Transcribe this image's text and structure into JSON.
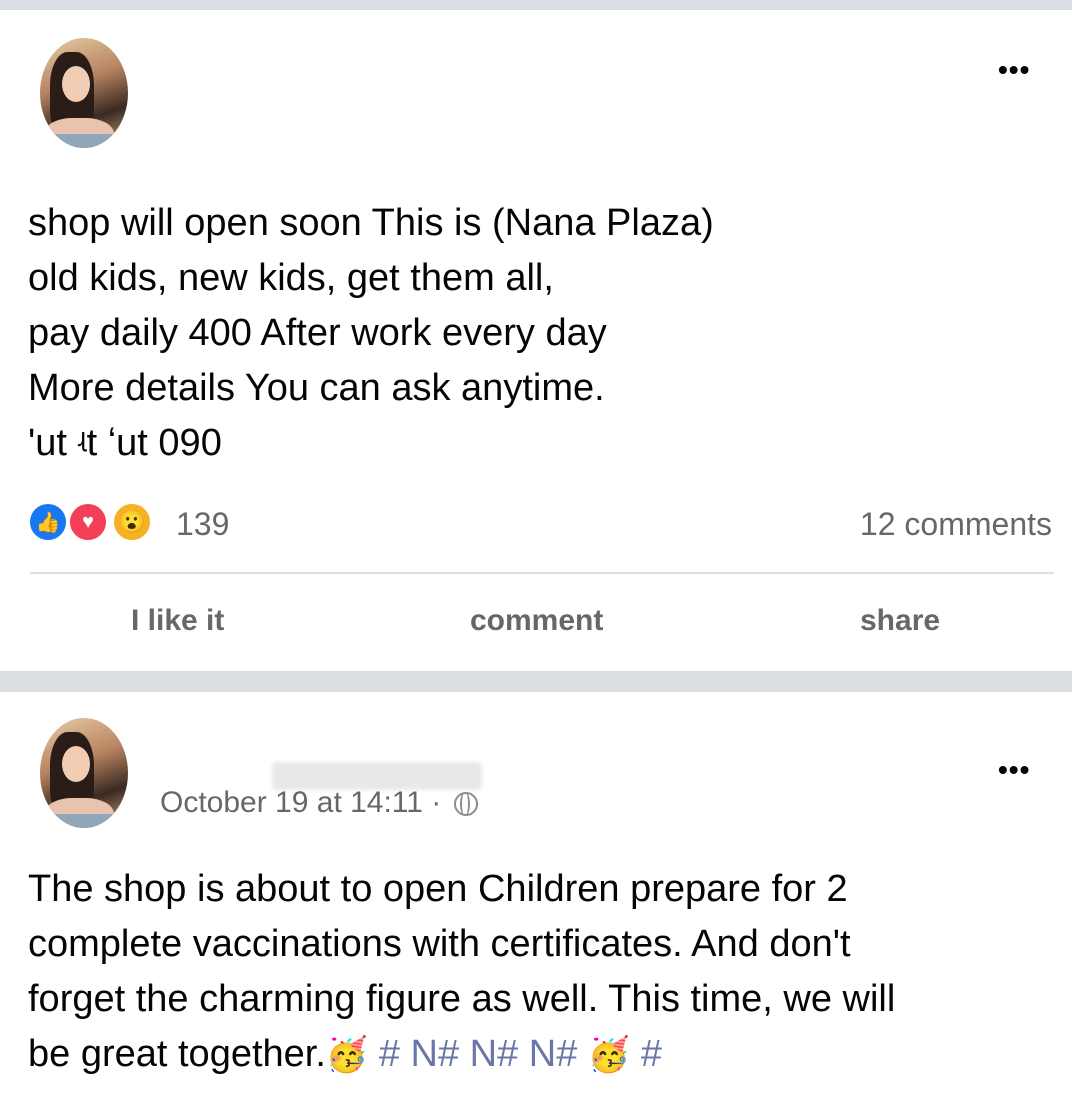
{
  "post1": {
    "lines": [
      "shop will open soon This is (Nana Plaza)",
      "old kids, new kids, get them all,",
      "pay daily 400 After work every day",
      "More details You can ask anytime.",
      "'ut ʵt ʻut 090"
    ],
    "more_icon": "•••",
    "reactions": {
      "icons": [
        "like-icon",
        "love-icon",
        "wow-icon"
      ],
      "like_glyph": "👍",
      "love_glyph": "♥",
      "wow_glyph": "😮",
      "count": "139"
    },
    "comments": "12 comments",
    "actions": {
      "like": "I like it",
      "comment": "comment",
      "share": "share"
    }
  },
  "post2": {
    "more_icon": "•••",
    "timestamp": "October 19 at 14:11 ·",
    "lines": [
      "The shop is about to open Children prepare for 2",
      "complete vaccinations with certificates. And don't",
      "forget the charming figure as well. This time, we will",
      "be great together."
    ],
    "trail_emoji": "🥳",
    "hashtags": "# N# N# N#",
    "trail_emoji2": "🥳",
    "trail_hash": "#"
  },
  "colors": {
    "separator": "#dadde1",
    "secondary_text": "#65676b",
    "like_blue": "#1877f2",
    "love_red": "#f33e58",
    "wow_yellow": "#f7b125"
  }
}
